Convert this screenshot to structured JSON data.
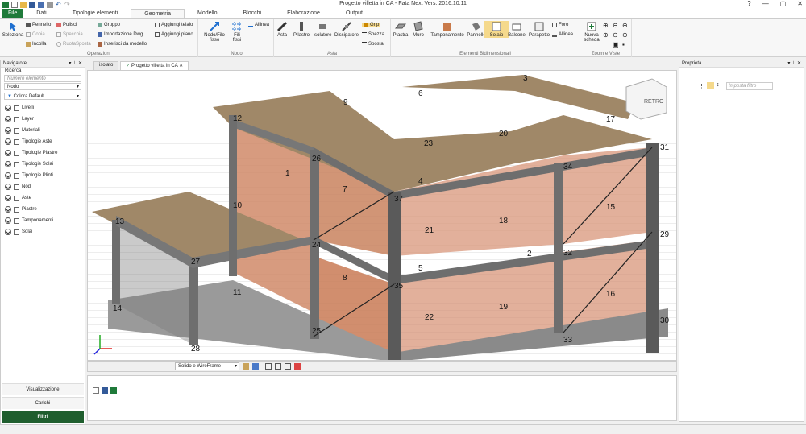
{
  "app": {
    "title": "Progetto villetta in CA - Fata Next Vers. 2016.10.11"
  },
  "menu": [
    "File",
    "Dati",
    "Tipologie elementi",
    "Geometria",
    "Modello",
    "Blocchi",
    "Elaborazione",
    "Output"
  ],
  "ribbon": {
    "seleziona": "Seleziona",
    "pennello": "Pennello",
    "pulisci": "Pulisci",
    "copia": "Copia",
    "specchia": "Specchia",
    "incolla": "Incolla",
    "ruota": "RuotaSposta",
    "gruppo": "Gruppo",
    "importazione": "Importazione Dwg",
    "inserisci": "Inserisci da modello",
    "aggiungi_telaio": "Aggiungi telaio",
    "aggiungi_piano": "Aggiungi piano",
    "operazioni": "Operazioni",
    "nodo_filo_1": "Nodo/Filo",
    "nodo_filo_2": "fisso",
    "fili_1": "Fili",
    "fili_2": "fissi",
    "allinea": "Allinea",
    "nodo": "Nodo",
    "asta": "Asta",
    "pilastro": "Pilastro",
    "isolatore": "Isolatore",
    "dissipatore": "Dissipatore",
    "grip": "Grip",
    "spezza": "Spezza",
    "sposta": "Sposta",
    "asta_group": "Asta",
    "piastra": "Piastra",
    "muro": "Muro",
    "tamponamento": "Tamponamento",
    "pannello": "Pannello",
    "solaio": "Solaio",
    "balcone": "Balcone",
    "parapetto": "Parapetto",
    "foro": "Foro",
    "allinea2": "Allinea",
    "elementi": "Elementi Bidimensionali",
    "nuova_1": "Nuova",
    "nuova_2": "scheda",
    "zoom": "Zoom e Viste"
  },
  "navigator": {
    "title": "Navigatore",
    "ricerca": "Ricerca",
    "placeholder": "Numero elemento",
    "nodo": "Nodo",
    "colora": "Colora Default",
    "items": [
      "Livelli",
      "Layer",
      "Materiali",
      "Tipologie Aste",
      "Tipologie Piastre",
      "Tipologie Solai",
      "Tipologie Plinti",
      "Nodi",
      "Aste",
      "Piastre",
      "Tamponamenti",
      "Solai"
    ],
    "bottom": [
      "Visualizzazione",
      "Carichi",
      "Filtri"
    ]
  },
  "doctabs": [
    "isolato",
    "Progetto villetta in CA"
  ],
  "viewcube": "RETRO",
  "viewmode": "Solido e WireFrame",
  "properties": {
    "title": "Proprietà",
    "filter": "Imposta filtro"
  },
  "nodes": [
    "1",
    "2",
    "3",
    "4",
    "5",
    "7",
    "8",
    "9",
    "10",
    "11",
    "12",
    "13",
    "14",
    "15",
    "16",
    "17",
    "18",
    "19",
    "20",
    "21",
    "22",
    "23",
    "24",
    "25",
    "26",
    "27",
    "28",
    "29",
    "30",
    "31",
    "32",
    "33",
    "34",
    "35",
    "37",
    "6"
  ],
  "colors": {
    "accent": "#1f7a3a",
    "slab": "#a08868",
    "beam": "#6e6e6e",
    "wall": "#d08a68"
  }
}
